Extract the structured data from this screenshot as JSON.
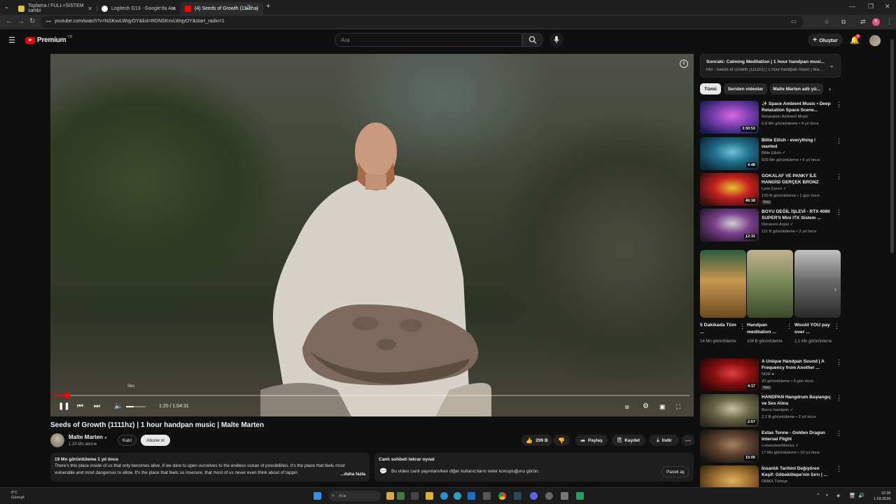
{
  "browser": {
    "tabs": [
      {
        "label": "Toplama / FULL+SİSTEM sahibi",
        "fav": "#d9c24e",
        "active": false
      },
      {
        "label": "Logitech G13 - Google'da Ara",
        "fav": "#ffffff",
        "active": false
      },
      {
        "label": "(4) Seeds of Growth (1111hz)",
        "fav": "#ff0000",
        "active": true
      }
    ],
    "url": "youtube.com/watch?v=NSKxvLWqyOY&list=RDNSKxvLWqyOY&start_radio=1",
    "profile_letter": "K"
  },
  "header": {
    "logo": "Premium",
    "country": "TR",
    "search_placeholder": "Ara",
    "create_label": "Oluştur",
    "notif_count": "4"
  },
  "player": {
    "progress": 0.02,
    "volume": 0.4,
    "volume_tooltip": "Ses",
    "time": "1:20 / 1:04:31"
  },
  "video": {
    "title": "Seeds of Growth (1111hz) | 1 hour handpan music | Malte Marten",
    "channel": "Malte Marten",
    "subs": "1,33 Mn abone",
    "join_label": "Katıl",
    "subscribe_label": "Abone ol",
    "likes": "299 B",
    "share_label": "Paylaş",
    "save_label": "Kaydet",
    "download_label": "İndir"
  },
  "description": {
    "meta": "19 Mn görüntüleme  1 yıl önce",
    "text": "There's this place inside of us that only becomes alive, if we dare to open ourselves to the endless ocean of possibilities. It's the place that feels most vulnerable and most dangerous to allow. It's the place that feels so insecure, that most of us never even think about of tappin",
    "more": "...daha fazla"
  },
  "chat": {
    "title": "Canlı sohbeti tekrar oynat",
    "message": "Bu video canlı yayınlanırken diğer kullanıcıların neler konuştuğunu görün.",
    "button": "Paneli aç"
  },
  "sidebar": {
    "next_title": "Sonraki: Calming Meditation | 1 hour handpan musi...",
    "next_sub": "Mix - Seeds of Growth (1111hz) | 1 hour handpan music | Ma...",
    "chips": [
      "Tümü",
      "Seriden videolar",
      "Malte Marten adlı yü..."
    ],
    "recs": [
      {
        "title": "✨ Space Ambient Music • Deep Relaxation Space Scene...",
        "channel": "Relaxation Ambient Music",
        "views": "6,8 Mn görüntüleme • 4 yıl önce",
        "duration": "3:30:53",
        "badge": "",
        "colors": [
          "#1a1d54",
          "#7b3fb0",
          "#d96ae0"
        ]
      },
      {
        "title": "Billie Eilish - everything i wanted",
        "channel": "Billie Eilish ✓",
        "views": "509 Mn görüntüleme • 6 yıl önce",
        "duration": "4:48",
        "badge": "",
        "colors": [
          "#0e2a3a",
          "#1f6e8a",
          "#6bc3d6"
        ]
      },
      {
        "title": "GOKALAF VE PANKY İLE HANGİSİ GERÇEK BRONZ",
        "channel": "Lynx Çerez ✓",
        "views": "120 B görüntüleme • 1 gün önce",
        "duration": "46:18",
        "badge": "Yeni",
        "colors": [
          "#3a1010",
          "#c42020",
          "#e8c230"
        ]
      },
      {
        "title": "BOYU DEĞİL İŞLEVİ - RTX 4080 SUPER'li Mini ITX Sistem ...",
        "channel": "Donanım Arşivi ✓",
        "views": "111 B görüntüleme • 2 yıl önce",
        "duration": "12:31",
        "badge": "",
        "colors": [
          "#2a1a30",
          "#7a3f8e",
          "#d0d0d0"
        ]
      },
      {
        "title": "A Unique Handpan Sound | A Frequency from Another ...",
        "channel": "NOR ●",
        "views": "20 görüntüleme • 3 gün önce",
        "duration": "4:17",
        "badge": "Yeni",
        "colors": [
          "#2a0606",
          "#8a1010",
          "#e04040"
        ]
      },
      {
        "title": "HANDPAN Hangdrum Başlangıç ve Ses Alma",
        "channel": "Burcu handpan ✓",
        "views": "2,2 B görüntüleme • 2 yıl önce",
        "duration": "2:57",
        "badge": "",
        "colors": [
          "#2a2a20",
          "#6a6648",
          "#c9c3a4"
        ]
      },
      {
        "title": "Estas Tonne - Golden Dragon Internal Flight",
        "channel": "LebensteinMovies ✓",
        "views": "17 Mn görüntüleme • 10 yıl önce",
        "duration": "15:05",
        "badge": "",
        "colors": [
          "#1a1410",
          "#5a4030",
          "#a88060"
        ]
      },
      {
        "title": "İnsanlık Tarihini Değiştiren Keşif: Göbeklitepe'nin Sırrı | ...",
        "channel": "DMAX Türkiye",
        "views": "",
        "duration": "",
        "badge": "",
        "colors": [
          "#3a2a10",
          "#a07030",
          "#e0b060"
        ]
      }
    ],
    "shorts": [
      {
        "title": "5 Dakikada Tüm ...",
        "views": "14 Mn görüntüleme",
        "colors": [
          "#6b4a20",
          "#c89850",
          "#2c5a40"
        ]
      },
      {
        "title": "Handpan meditation ...",
        "views": "104 B görüntüleme",
        "colors": [
          "#3a4a2a",
          "#7d8a5a",
          "#c2b090"
        ]
      },
      {
        "title": "Would YOU pay over ...",
        "views": "1,1 Mn görüntüleme",
        "colors": [
          "#2a2a2a",
          "#6a6a6a",
          "#c0c0c0"
        ]
      }
    ]
  },
  "taskbar": {
    "weather_temp": "8°C",
    "weather_desc": "Güneşli",
    "search": "Ara",
    "time": "12:36",
    "date": "1.03.2026"
  }
}
